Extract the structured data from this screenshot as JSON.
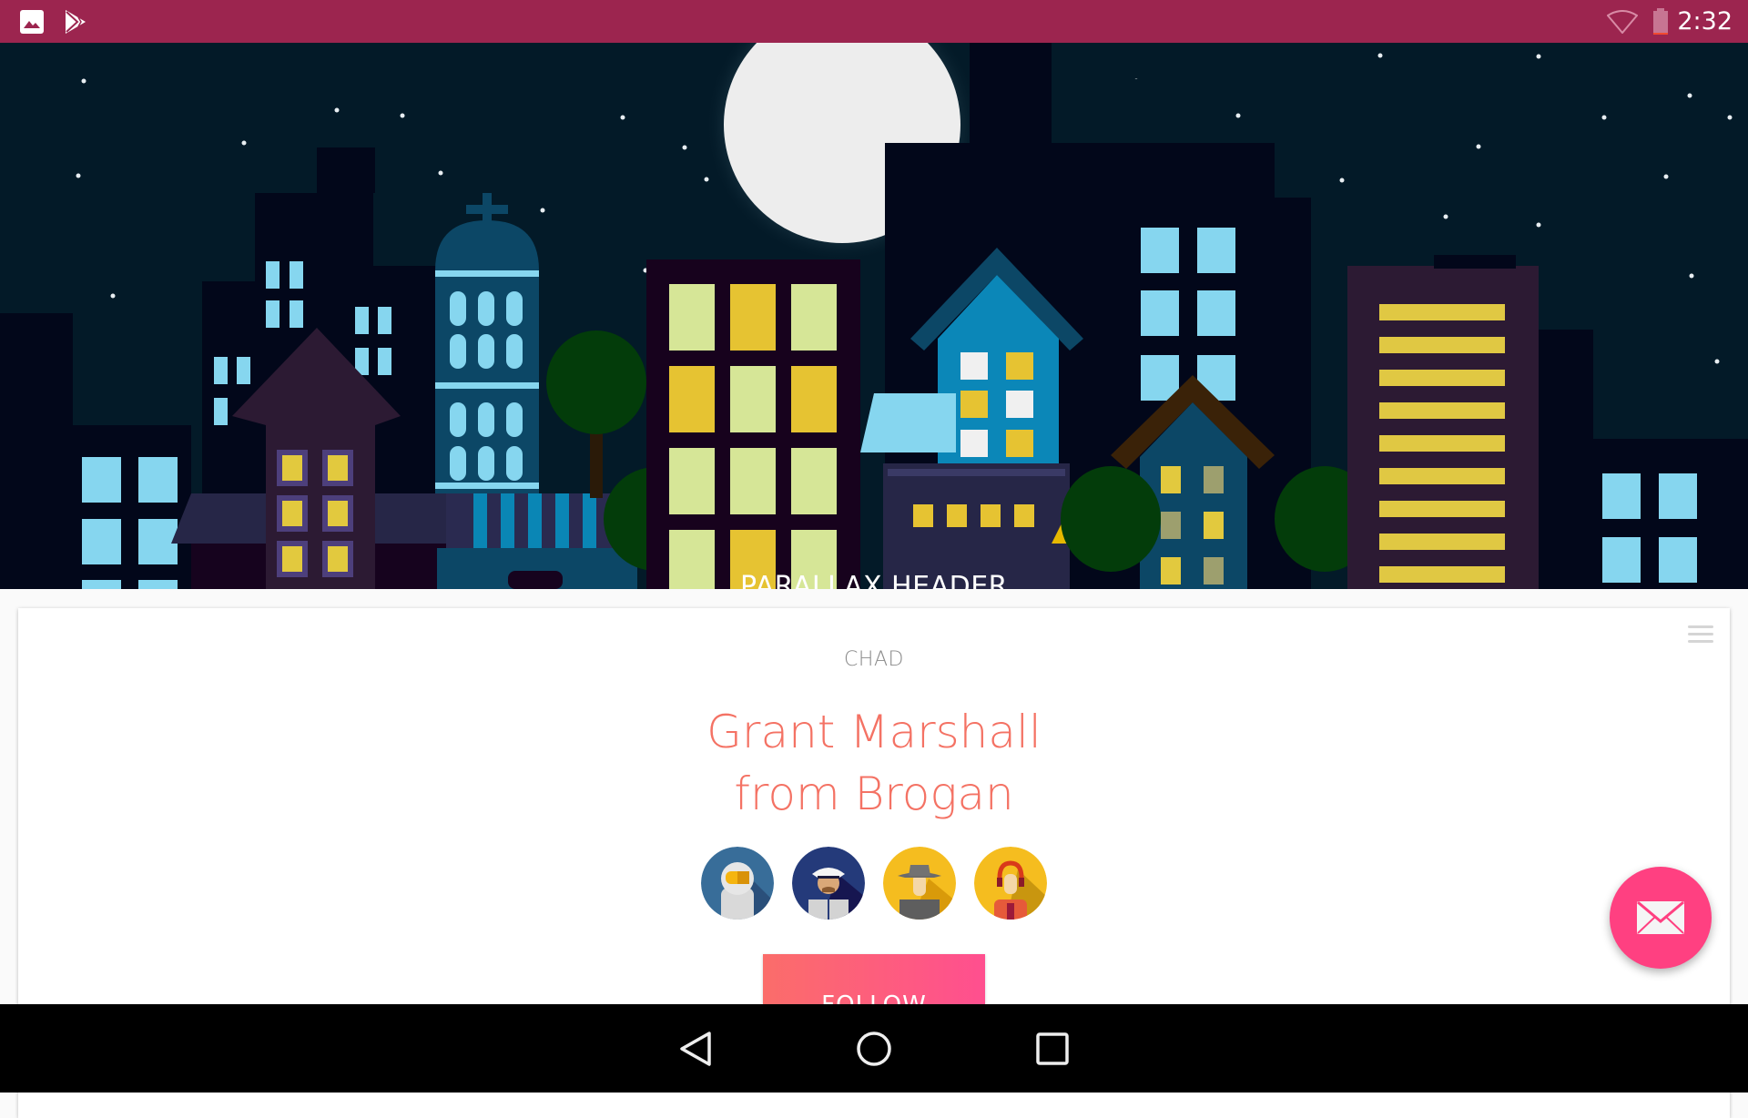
{
  "status_bar": {
    "time": "2:32",
    "left_icons": [
      "image-icon",
      "play-store-icon"
    ],
    "right_icons": [
      "wifi-icon",
      "battery-icon"
    ],
    "background": "#9c254f"
  },
  "header": {
    "title": "PARALLAX HEADER",
    "illustration": "night-city-skyline"
  },
  "card": {
    "overline": "CHAD",
    "name_line1": "Grant Marshall",
    "name_line2": "from Brogan",
    "avatars": [
      {
        "name": "astronaut"
      },
      {
        "name": "captain"
      },
      {
        "name": "detective"
      },
      {
        "name": "operator"
      }
    ],
    "follow_label": "FOLLOW",
    "menu_icon": "hamburger-menu-icon",
    "name_color": "#f47264"
  },
  "fab": {
    "icon": "mail-icon",
    "color": "#ff4081"
  },
  "nav_bar": {
    "buttons": [
      "back",
      "home",
      "recents"
    ]
  }
}
